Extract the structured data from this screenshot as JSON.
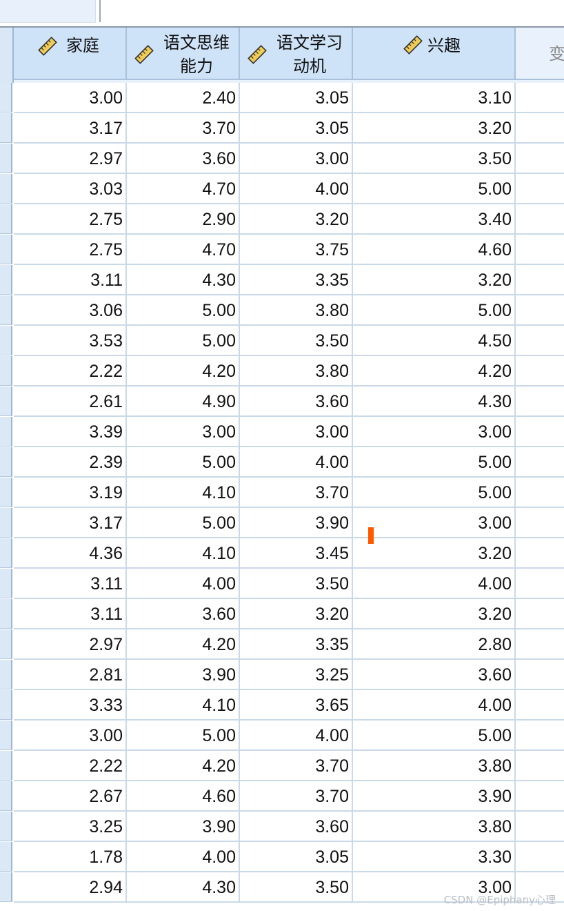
{
  "columns": [
    {
      "label": "家庭",
      "icon": "ruler-icon"
    },
    {
      "label": "语文思维\n能力",
      "icon": "ruler-icon"
    },
    {
      "label": "语文学习\n动机",
      "icon": "ruler-icon"
    },
    {
      "label": "兴趣",
      "icon": "ruler-icon"
    },
    {
      "label": "变",
      "icon": ""
    }
  ],
  "rows": [
    [
      "3.00",
      "2.40",
      "3.05",
      "3.10"
    ],
    [
      "3.17",
      "3.70",
      "3.05",
      "3.20"
    ],
    [
      "2.97",
      "3.60",
      "3.00",
      "3.50"
    ],
    [
      "3.03",
      "4.70",
      "4.00",
      "5.00"
    ],
    [
      "2.75",
      "2.90",
      "3.20",
      "3.40"
    ],
    [
      "2.75",
      "4.70",
      "3.75",
      "4.60"
    ],
    [
      "3.11",
      "4.30",
      "3.35",
      "3.20"
    ],
    [
      "3.06",
      "5.00",
      "3.80",
      "5.00"
    ],
    [
      "3.53",
      "5.00",
      "3.50",
      "4.50"
    ],
    [
      "2.22",
      "4.20",
      "3.80",
      "4.20"
    ],
    [
      "2.61",
      "4.90",
      "3.60",
      "4.30"
    ],
    [
      "3.39",
      "3.00",
      "3.00",
      "3.00"
    ],
    [
      "2.39",
      "5.00",
      "4.00",
      "5.00"
    ],
    [
      "3.19",
      "4.10",
      "3.70",
      "5.00"
    ],
    [
      "3.17",
      "5.00",
      "3.90",
      "3.00"
    ],
    [
      "4.36",
      "4.10",
      "3.45",
      "3.20"
    ],
    [
      "3.11",
      "4.00",
      "3.50",
      "4.00"
    ],
    [
      "3.11",
      "3.60",
      "3.20",
      "3.20"
    ],
    [
      "2.97",
      "4.20",
      "3.35",
      "2.80"
    ],
    [
      "2.81",
      "3.90",
      "3.25",
      "3.60"
    ],
    [
      "3.33",
      "4.10",
      "3.65",
      "4.00"
    ],
    [
      "3.00",
      "5.00",
      "4.00",
      "5.00"
    ],
    [
      "2.22",
      "4.20",
      "3.70",
      "3.80"
    ],
    [
      "2.67",
      "4.60",
      "3.70",
      "3.90"
    ],
    [
      "3.25",
      "3.90",
      "3.60",
      "3.80"
    ],
    [
      "1.78",
      "4.00",
      "3.05",
      "3.30"
    ],
    [
      "2.94",
      "4.30",
      "3.50",
      "3.00"
    ]
  ],
  "watermark": "CSDN @Epiphany心理",
  "colors": {
    "header_bg": "#cfe3f8",
    "grid_line": "#c9d9ea",
    "cursor": "#ff5a00"
  }
}
